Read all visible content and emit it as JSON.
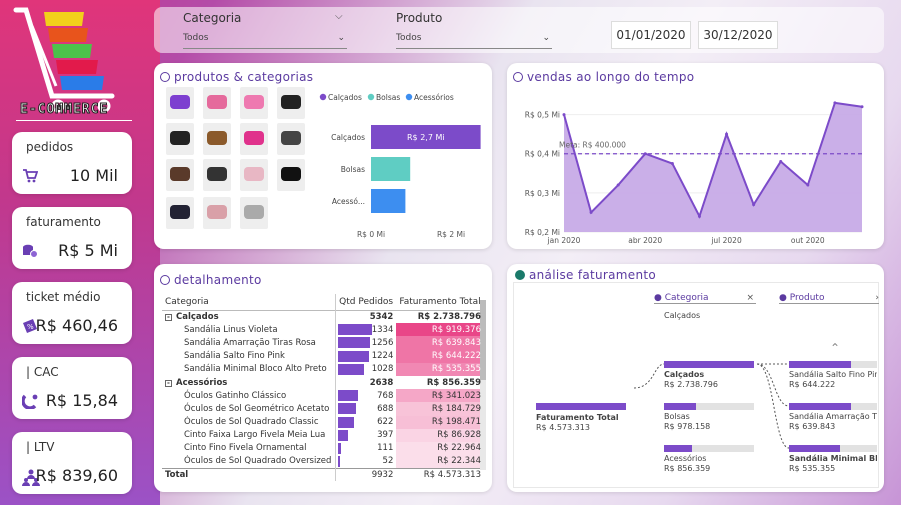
{
  "logo": {
    "text": "E-COMMERCE"
  },
  "kpis": [
    {
      "title": "pedidos",
      "value": "10 Mil",
      "icon": "cart-icon"
    },
    {
      "title": "faturamento",
      "value": "R$ 5 Mi",
      "icon": "money-icon"
    },
    {
      "title": "ticket médio",
      "value": "R$ 460,46",
      "icon": "ticket-icon"
    },
    {
      "title": "| CAC",
      "value": "R$ 15,84",
      "icon": "magnet-icon"
    },
    {
      "title": "| LTV",
      "value": "R$ 839,60",
      "icon": "users-icon"
    }
  ],
  "filters": {
    "categoria_label": "Categoria",
    "categoria_value": "Todos",
    "produto_label": "Produto",
    "produto_value": "Todos",
    "date_start": "01/01/2020",
    "date_end": "30/12/2020"
  },
  "produtos": {
    "title": "produtos & categorias",
    "legend": [
      "Calçados",
      "Bolsas",
      "Acessórios"
    ],
    "colors": {
      "calcados": "#7c4bc9",
      "bolsas": "#5fcdc3",
      "acessorios": "#3d8ef0",
      "accent": "#5b3aa0"
    }
  },
  "chart_data": [
    {
      "type": "bar",
      "orientation": "horizontal",
      "categories": [
        "Calçados",
        "Bolsas",
        "Acessó..."
      ],
      "values": [
        2.74,
        0.98,
        0.86
      ],
      "data_labels": [
        "R$ 2,7 Mi",
        "",
        ""
      ],
      "xticks": [
        "R$ 0 Mi",
        "R$ 2 Mi"
      ],
      "xlim": [
        0,
        3
      ],
      "legend_position": "top"
    },
    {
      "type": "area",
      "title": "vendas ao longo do tempo",
      "x": [
        "jan",
        "fev",
        "mar",
        "abr",
        "mai",
        "jun",
        "jul",
        "ago",
        "set",
        "out",
        "nov",
        "dez"
      ],
      "xticks": [
        "jan 2020",
        "abr 2020",
        "jul 2020",
        "out 2020"
      ],
      "values": [
        500000,
        250000,
        320000,
        400000,
        375000,
        240000,
        450000,
        270000,
        380000,
        320000,
        530000,
        520000
      ],
      "yticks": [
        "R$ 0,5 Mi",
        "R$ 0,4 Mi",
        "R$ 0,3 Mi",
        "R$ 0,2 Mi"
      ],
      "ylim": [
        200000,
        550000
      ],
      "reference_line": {
        "label": "Meta: R$ 400.000",
        "value": 400000
      }
    }
  ],
  "detalhamento": {
    "title": "detalhamento",
    "headers": [
      "Categoria",
      "Qtd Pedidos",
      "Faturamento Total"
    ],
    "rows": [
      {
        "level": 0,
        "name": "Calçados",
        "qtd": "5342",
        "fat": "R$ 2.738.796",
        "q": 0,
        "f": 0
      },
      {
        "level": 1,
        "name": "Sandália Linus Violeta",
        "qtd": "1334",
        "fat": "R$ 919.376",
        "q": 1.0,
        "f": 1.0
      },
      {
        "level": 1,
        "name": "Sandália Amarração Tiras Rosa",
        "qtd": "1256",
        "fat": "R$ 639.843",
        "q": 0.94,
        "f": 0.7
      },
      {
        "level": 1,
        "name": "Sandália Salto Fino Pink",
        "qtd": "1224",
        "fat": "R$ 644.222",
        "q": 0.92,
        "f": 0.7
      },
      {
        "level": 1,
        "name": "Sandália Minimal Bloco Alto Preto",
        "qtd": "1028",
        "fat": "R$ 535.355",
        "q": 0.77,
        "f": 0.58
      },
      {
        "level": 0,
        "name": "Acessórios",
        "qtd": "2638",
        "fat": "R$ 856.359",
        "q": 0,
        "f": 0
      },
      {
        "level": 1,
        "name": "Óculos Gatinho Clássico",
        "qtd": "768",
        "fat": "R$ 341.023",
        "q": 0.58,
        "f": 0.37
      },
      {
        "level": 1,
        "name": "Óculos de Sol Geométrico Acetato",
        "qtd": "688",
        "fat": "R$ 184.729",
        "q": 0.52,
        "f": 0.2
      },
      {
        "level": 1,
        "name": "Óculos de Sol Quadrado Classic",
        "qtd": "622",
        "fat": "R$ 198.471",
        "q": 0.47,
        "f": 0.22
      },
      {
        "level": 1,
        "name": "Cinto Faixa Largo Fivela Meia Lua",
        "qtd": "397",
        "fat": "R$ 86.928",
        "q": 0.3,
        "f": 0.09
      },
      {
        "level": 1,
        "name": "Cinto Fino Fivela Ornamental",
        "qtd": "111",
        "fat": "R$ 22.964",
        "q": 0.08,
        "f": 0.025
      },
      {
        "level": 1,
        "name": "Óculos de Sol Quadrado Oversized",
        "qtd": "52",
        "fat": "R$ 22.344",
        "q": 0.04,
        "f": 0.024
      }
    ],
    "total_label": "Total",
    "total_qtd": "9932",
    "total_fat": "R$ 4.573.313"
  },
  "analise": {
    "title": "análise faturamento",
    "col1_label": "Categoria",
    "col1_filter": "Calçados",
    "col2_label": "Produto",
    "root": {
      "name": "Faturamento Total",
      "value": "R$ 4.573.313"
    },
    "categories": [
      {
        "name": "Calçados",
        "value": "R$ 2.738.796",
        "pct": 1.0
      },
      {
        "name": "Bolsas",
        "value": "R$ 978.158",
        "pct": 0.36
      },
      {
        "name": "Acessórios",
        "value": "R$ 856.359",
        "pct": 0.31
      }
    ],
    "products": [
      {
        "name": "Sandália Salto Fino Pin",
        "value": "R$ 644.222",
        "pct": 0.7
      },
      {
        "name": "Sandália Amarração Ti...",
        "value": "R$ 639.843",
        "pct": 0.7
      },
      {
        "name": "Sandália Minimal Bloc...",
        "value": "R$ 535.355",
        "pct": 0.58
      }
    ]
  }
}
